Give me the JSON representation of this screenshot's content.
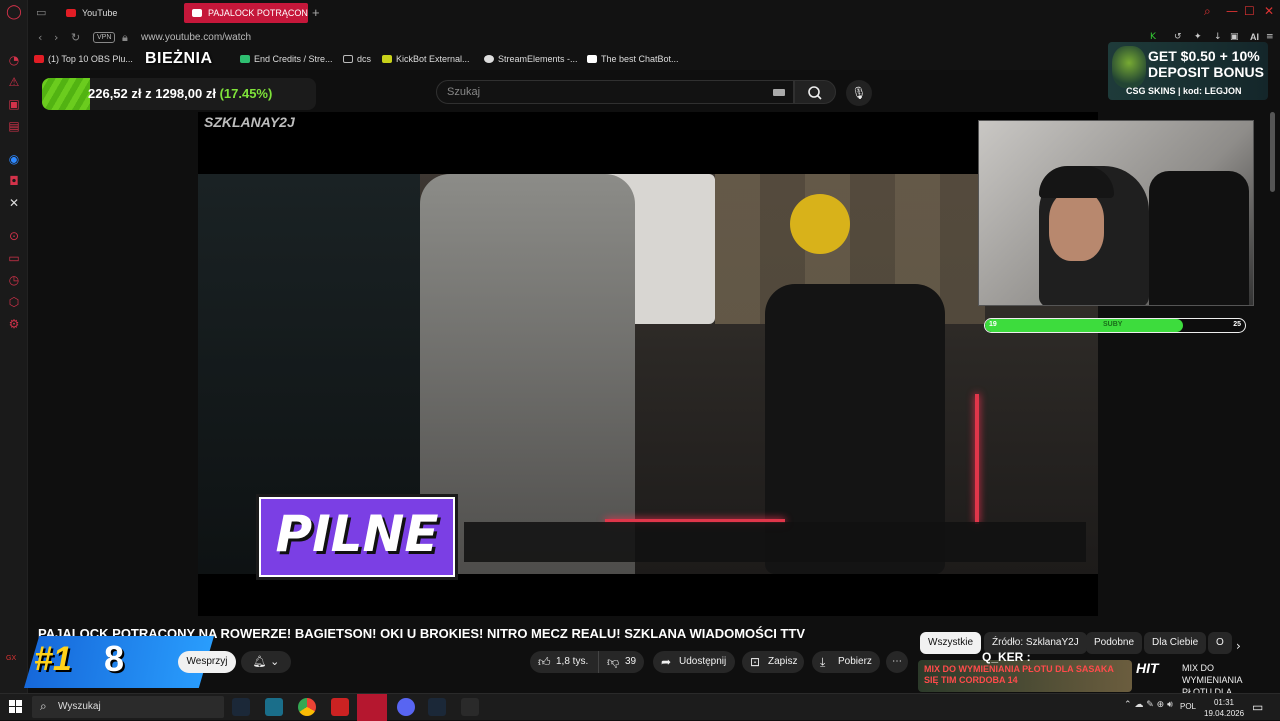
{
  "browser": {
    "tabs": [
      {
        "label": "YouTube"
      },
      {
        "label": "PAJALOCK POTRĄCON"
      }
    ],
    "new_tab_symbol": "+",
    "vpn_label": "VPN",
    "url": "www.youtube.com/watch",
    "bookmarks": [
      {
        "label": "(1) Top 10 OBS Plu..."
      },
      {
        "label": "End Credits / Stre..."
      },
      {
        "label": "dcs"
      },
      {
        "label": "KickBot External..."
      },
      {
        "label": "StreamElements -..."
      },
      {
        "label": "The best ChatBot..."
      }
    ],
    "ext_ai": "AI",
    "accent": "#c5173a"
  },
  "overlay": {
    "biezna": "BIEŻNIA",
    "progress_text": "226,52 zł z 1298,00 zł",
    "progress_pct": "(17.45%)",
    "progress_value": 0.1745,
    "ad_line1": "GET $0.50 + 10%",
    "ad_line2": "DEPOSIT BONUS",
    "ad_line3": "CSG SKINS | kod: LEGJON",
    "channel_watermark": "SZKLANAY2J",
    "pilne": "PILNE",
    "sub_left": "19",
    "sub_label": "SUBY",
    "sub_right": "25",
    "sub_value": 0.76,
    "rank_no": "#1",
    "rank_val": "8",
    "corner_tag": "GX"
  },
  "youtube": {
    "search_placeholder": "Szukaj",
    "video_title": "PAJALOCK POTRĄCONY NA ROWERZE! BAGIETSON! OKI U BROKIES! NITRO MECZ REALU! SZKLANA WIADOMOŚCI TTV",
    "support_label": "Wesprzyj",
    "likes": "1,8 tys.",
    "dislikes": "39",
    "share_label": "Udostępnij",
    "save_label": "Zapisz",
    "download_label": "Pobierz",
    "chips": [
      "Wszystkie",
      "Źródło: SzklanaY2J",
      "Podobne",
      "Dla Ciebie",
      "O"
    ],
    "rec_thumb_text": "MIX DO WYMIENIANIA PŁOTU DLA SASAKA SIĘ TIM CORDOBA 14",
    "rec_overlay": "Q_KER :",
    "rec_hit": "HIT",
    "rec_title": "MIX DO WYMIENIANIA PŁOTU DLA ..."
  },
  "taskbar": {
    "search_placeholder": "Wyszukaj",
    "lang": "POL",
    "time": "01:31",
    "date": "19.04.2026"
  }
}
